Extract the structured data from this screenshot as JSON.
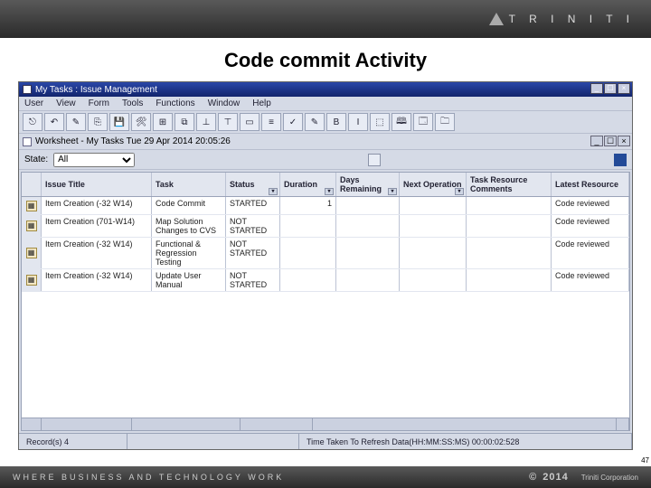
{
  "brand": "T R I N I T I",
  "slide_title": "Code commit Activity",
  "window": {
    "title": "My Tasks : Issue Management"
  },
  "menu": {
    "items": [
      "User",
      "View",
      "Form",
      "Tools",
      "Functions",
      "Window",
      "Help"
    ]
  },
  "toolbar": {
    "glyphs": [
      "⎋",
      "↶",
      "✎",
      "⎘",
      "💾",
      "🛠",
      "⊞",
      "⧉",
      "⊥",
      "⊤",
      "▭",
      "≡",
      "✓",
      "✎",
      "B",
      "I",
      "⬚",
      "🕮",
      "🗔",
      "🗀"
    ]
  },
  "worksheet": {
    "label": "Worksheet - My Tasks  Tue 29 Apr 2014 20:05:26"
  },
  "filter": {
    "label": "State:",
    "value": "All",
    "options": [
      "All"
    ]
  },
  "columns": [
    "Issue Title",
    "Task",
    "Status",
    "Duration",
    "Days Remaining",
    "Next Operation",
    "Task Resource Comments",
    "Latest Resource"
  ],
  "rows": [
    {
      "title": "Item Creation (-32 W14)",
      "task": "Code Commit",
      "status": "STARTED",
      "duration": "1",
      "days": "",
      "next": "",
      "comments": "",
      "latest": "Code reviewed"
    },
    {
      "title": "Item Creation (701-W14)",
      "task": "Map Solution Changes to CVS",
      "status": "NOT STARTED",
      "duration": "",
      "days": "",
      "next": "",
      "comments": "",
      "latest": "Code reviewed"
    },
    {
      "title": "Item Creation (-32 W14)",
      "task": "Functional & Regression Testing",
      "status": "NOT STARTED",
      "duration": "",
      "days": "",
      "next": "",
      "comments": "",
      "latest": "Code reviewed"
    },
    {
      "title": "Item Creation (-32 W14)",
      "task": "Update User Manual",
      "status": "NOT STARTED",
      "duration": "",
      "days": "",
      "next": "",
      "comments": "",
      "latest": "Code reviewed"
    }
  ],
  "status": {
    "records": "Record(s) 4",
    "timing": "Time Taken To Refresh Data(HH:MM:SS:MS) 00:00:02:528"
  },
  "footer": {
    "tag": "WHERE BUSINESS AND TECHNOLOGY WORK",
    "copy": "©",
    "year": "2014",
    "corp": "Triniti Corporation"
  },
  "page_no": "47"
}
